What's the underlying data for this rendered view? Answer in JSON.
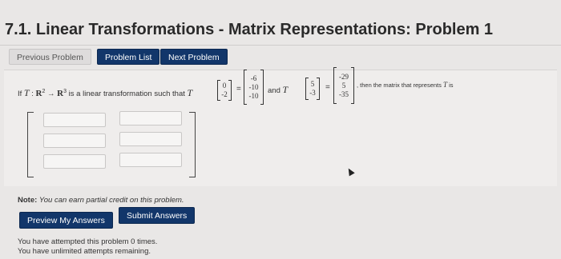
{
  "page": {
    "title": "7.1. Linear Transformations - Matrix Representations: Problem 1"
  },
  "nav": {
    "previous_label": "Previous Problem",
    "list_label": "Problem List",
    "next_label": "Next Problem"
  },
  "problem": {
    "if": "If",
    "T": "T",
    "domain": "R",
    "domain_exp": "2",
    "arrow": "→",
    "codomain": "R",
    "codomain_exp": "3",
    "text1": "is a linear transformation such that",
    "and": "and",
    "text2": ", then the matrix that represents",
    "is": "is",
    "v1": [
      "0",
      "-2"
    ],
    "Tv1": [
      "-6",
      "-10",
      "-10"
    ],
    "v2": [
      "5",
      "-3"
    ],
    "Tv2": [
      "-29",
      "5",
      "-35"
    ],
    "eq": "="
  },
  "answer": {
    "rows": 3,
    "cols": 2,
    "values": [
      "",
      "",
      "",
      "",
      "",
      ""
    ]
  },
  "note": {
    "label": "Note:",
    "text": "You can earn partial credit on this problem."
  },
  "actions": {
    "preview_label": "Preview My Answers",
    "submit_label": "Submit Answers"
  },
  "status": {
    "attempts": "You have attempted this problem 0 times.",
    "remaining": "You have unlimited attempts remaining."
  }
}
